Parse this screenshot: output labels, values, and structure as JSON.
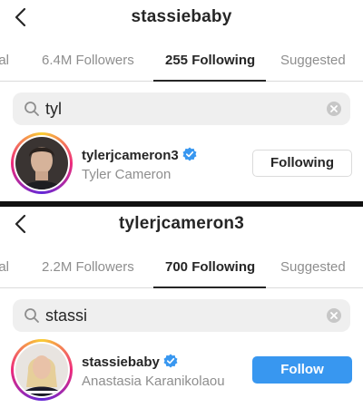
{
  "colors": {
    "accent": "#3897f0",
    "verified": "#3897f0",
    "muted": "#8e8e8e",
    "text": "#262626"
  },
  "top": {
    "title": "stassiebaby",
    "tabs": [
      {
        "label": "ual"
      },
      {
        "label": "6.4M Followers"
      },
      {
        "label": "255 Following",
        "active": true
      },
      {
        "label": "Suggested"
      }
    ],
    "search": {
      "value": "tyl",
      "icon": "search-icon"
    },
    "result": {
      "username": "tylerjcameron3",
      "fullname": "Tyler Cameron",
      "verified": true,
      "button": "Following"
    }
  },
  "bottom": {
    "title": "tylerjcameron3",
    "tabs": [
      {
        "label": "ual"
      },
      {
        "label": "2.2M Followers"
      },
      {
        "label": "700 Following",
        "active": true
      },
      {
        "label": "Suggested"
      }
    ],
    "search": {
      "value": "stassi",
      "icon": "search-icon"
    },
    "result": {
      "username": "stassiebaby",
      "fullname": "Anastasia Karanikolaou",
      "verified": true,
      "button": "Follow"
    }
  }
}
